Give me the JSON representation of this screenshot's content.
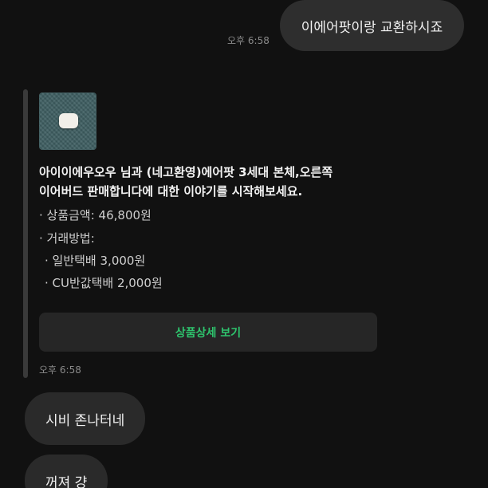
{
  "messages": {
    "outgoing": {
      "text": "이에어팟이랑 교환하시죠",
      "time": "오후 6:58"
    },
    "product_card": {
      "image_icon": "airpods-case-photo",
      "title_line1": "아이이에우오우 님과 (네고환영)에어팟 3세대 본체,오른쪽",
      "title_line2": "이어버드 판매합니다에 대한 이야기를 시작해보세요.",
      "price": "· 상품금액: 46,800원",
      "trade_method": "· 거래방법:",
      "shipping_1": "· 일반택배 3,000원",
      "shipping_2": "· CU반값택배 2,000원",
      "button_label": "상품상세 보기",
      "time": "오후 6:58",
      "accent_color": "#2ec46d"
    },
    "incoming": [
      {
        "text": "시비 존나터네"
      },
      {
        "text": "꺼져 걍"
      }
    ]
  }
}
